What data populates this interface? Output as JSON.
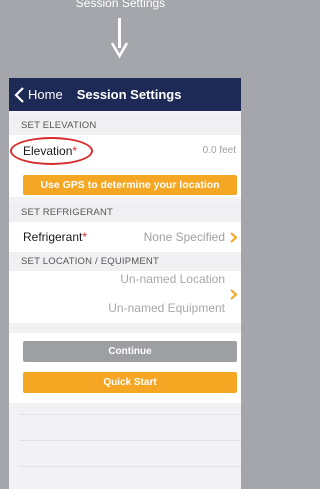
{
  "caption": {
    "text": "Session Settings"
  },
  "nav": {
    "back_label": "Home",
    "title": "Session Settings"
  },
  "elevation": {
    "header": "SET ELEVATION",
    "label": "Elevation",
    "required_mark": "*",
    "value": "0.0 feet",
    "gps_button": "Use GPS to determine your location"
  },
  "refrigerant": {
    "header": "SET REFRIGERANT",
    "label": "Refrigerant",
    "required_mark": "*",
    "value": "None Specified"
  },
  "location": {
    "header": "SET LOCATION / EQUIPMENT",
    "location_value": "Un-named Location",
    "equipment_value": "Un-named Equipment"
  },
  "actions": {
    "continue_label": "Continue",
    "quick_start_label": "Quick Start"
  },
  "colors": {
    "navbar": "#1c2a55",
    "accent_orange": "#f5a623",
    "highlight_circle": "#d72a2a",
    "disabled_button": "#9e9fa3"
  }
}
